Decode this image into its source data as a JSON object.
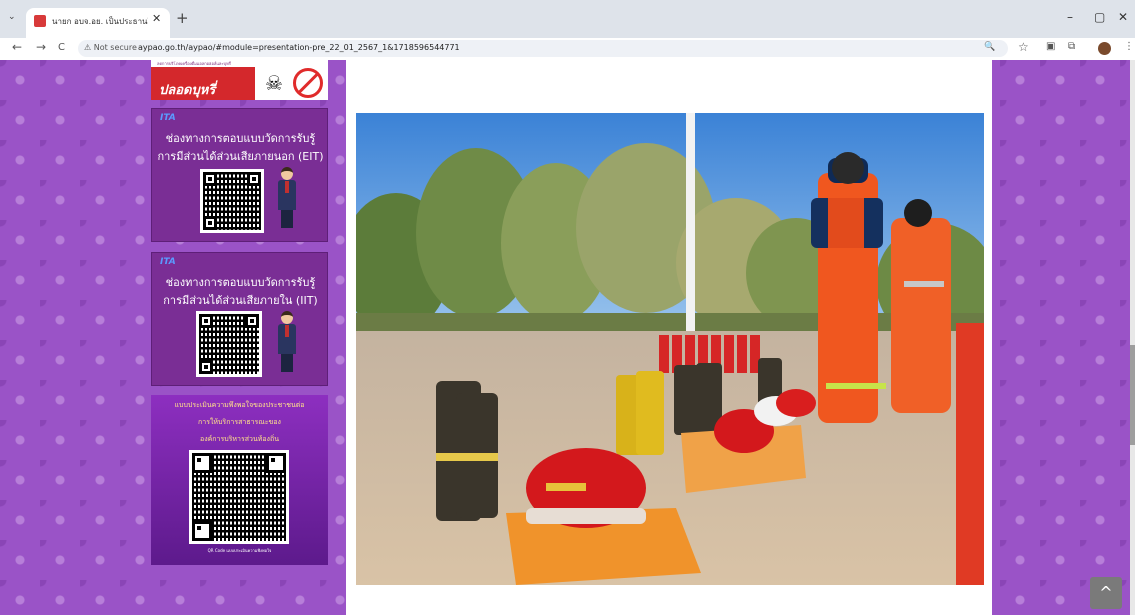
{
  "browser": {
    "tab_title": "นายก อบจ.อย. เป็นประธานในพิธีเปิด",
    "tab_close": "✕",
    "new_tab": "+",
    "not_secure": "⚠ Not secure",
    "url": "aypao.go.th/aypao/#module=presentation-pre_22_01_2567_1&1718596544771",
    "back": "←",
    "forward": "→",
    "reload": "C",
    "minimize": "–",
    "maximize": "▢",
    "close": "✕",
    "zoom_icon": "🔍",
    "star_icon": "☆"
  },
  "sidebar": {
    "top_banner": {
      "caption": "ลดการบริโภคเครื่องดื่มแอลกอฮอล์และบุหรี่",
      "text": "ปลอดบุหรี่"
    },
    "eit_panel": {
      "logo": "ITA",
      "line1": "ช่องทางการตอบแบบวัดการรับรู้",
      "line2": "การมีส่วนได้ส่วนเสียภายนอก (EIT)"
    },
    "iit_panel": {
      "logo": "ITA",
      "line1": "ช่องทางการตอบแบบวัดการรับรู้",
      "line2": "การมีส่วนได้ส่วนเสียภายใน (IIT)"
    },
    "survey_panel": {
      "line1": "แบบประเมินความพึงพอใจของประชาชนต่อ",
      "line2": "การให้บริการสาธารณะของ",
      "line3": "องค์การบริหารส่วนท้องถิ่น",
      "caption": "QR Code แบบประเมินความพึงพอใจ"
    }
  },
  "back_to_top": "^"
}
